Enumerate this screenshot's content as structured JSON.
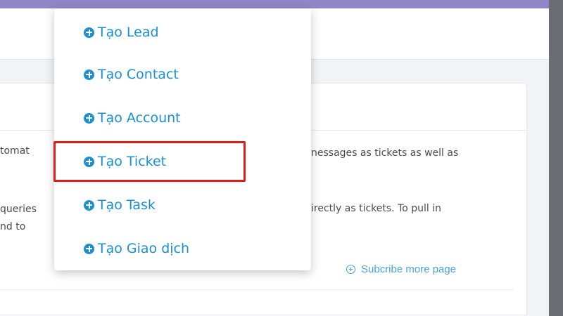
{
  "menu": {
    "items": [
      {
        "label": "Tạo Lead"
      },
      {
        "label": "Tạo Contact"
      },
      {
        "label": "Tạo Account"
      },
      {
        "label": "Tạo Ticket"
      },
      {
        "label": "Tạo Task"
      },
      {
        "label": "Tạo Giao dịch"
      }
    ],
    "highlighted_item": "Tạo Ticket"
  },
  "background": {
    "line1_left": "tomat",
    "line1_right": "nessages as tickets as well as",
    "line2_left": "queries",
    "line2_right": "irectly as tickets. To pull in",
    "line3_left": "nd to",
    "subscribe_label": "Subcribe more page"
  },
  "colors": {
    "topbar": "#8e86c6",
    "menu_text": "#1a8fd3",
    "highlight_border": "#e21a1a",
    "link": "#4aa3dd"
  }
}
